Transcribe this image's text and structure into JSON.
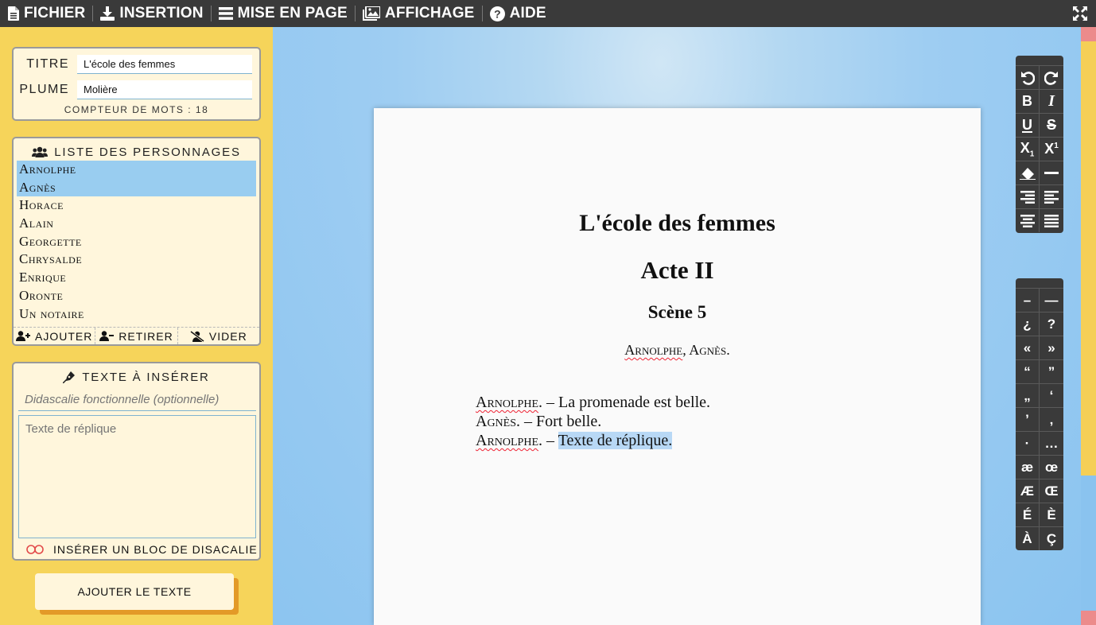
{
  "menu": {
    "items": [
      {
        "label": "FICHIER",
        "icon": "file-icon"
      },
      {
        "label": "INSERTION",
        "icon": "download-icon"
      },
      {
        "label": "MISE EN PAGE",
        "icon": "bars-icon"
      },
      {
        "label": "AFFICHAGE",
        "icon": "image-icon"
      },
      {
        "label": "AIDE",
        "icon": "question-icon"
      }
    ]
  },
  "meta": {
    "title_label": "Titre",
    "title_value": "L'école des femmes",
    "author_label": "Plume",
    "author_value": "Molière",
    "word_count_label": "Compteur de mots : 18"
  },
  "characters": {
    "header": "Liste des personnages",
    "items": [
      "Arnolphe",
      "Agnès",
      "Horace",
      "Alain",
      "Georgette",
      "Chrysalde",
      "Enrique",
      "Oronte",
      "Un notaire"
    ],
    "selected": [
      0,
      1
    ],
    "add_label": "Ajouter",
    "remove_label": "Retirer",
    "clear_label": "Vider"
  },
  "insert": {
    "header": "Texte à insérer",
    "didascalie_placeholder": "Didascalie fonctionnelle (optionnelle)",
    "replique_placeholder": "Texte de réplique",
    "toggle_label": "Insérer un bloc de disacalie",
    "add_button": "Ajouter le texte"
  },
  "document": {
    "title": "L'école des femmes",
    "act": "Acte II",
    "scene": "Scène 5",
    "characters_line": {
      "first": "Arnolphe",
      "sep": ", ",
      "second": "Agnès."
    },
    "lines": [
      {
        "speaker": "Arnolphe",
        "dash": ". – ",
        "text": "La promenade est belle."
      },
      {
        "speaker": "Agnès",
        "dash": ". – ",
        "text": "Fort belle."
      },
      {
        "speaker": "Arnolphe",
        "dash": ". – ",
        "text": "Texte de réplique."
      }
    ]
  },
  "toolbar_format": [
    "undo-icon",
    "redo-icon",
    "bold-icon",
    "italic-icon",
    "underline-icon",
    "strikethrough-icon",
    "subscript-icon",
    "superscript-icon",
    "eraser-icon",
    "horizontal-rule-icon",
    "align-right-icon",
    "align-left-icon",
    "align-center-icon",
    "align-justify-icon"
  ],
  "toolbar_chars": [
    "–",
    "—",
    "¿",
    "?",
    "«",
    "»",
    "“",
    "”",
    "„",
    "‘",
    "’",
    "‚",
    "·",
    "…",
    "æ",
    "œ",
    "Æ",
    "Œ",
    "É",
    "È",
    "À",
    "Ç"
  ],
  "colors": {
    "menubar": "#3a3a3a",
    "sidebar": "#f6d45a",
    "panel": "#fff6dc",
    "selection": "#99cdf0",
    "workspace": "#8bc4f0",
    "button_shadow": "#e39a28",
    "accent_red": "#ec8b8b"
  }
}
